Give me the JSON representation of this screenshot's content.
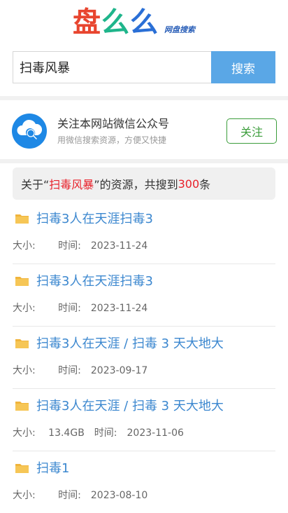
{
  "logo": {
    "char1": "盘",
    "char2": "么",
    "char3": "么",
    "subtitle": "网盘搜索"
  },
  "search": {
    "value": "扫毒风暴",
    "button": "搜索"
  },
  "wechat": {
    "title": "关注本网站微信公众号",
    "subtitle": "用微信搜索资源，方便又快捷",
    "button": "关注"
  },
  "summary": {
    "prefix": "关于“",
    "keyword": "扫毒风暴",
    "middle": "”的资源，共搜到",
    "count": "300",
    "suffix": "条"
  },
  "results": [
    {
      "title": "扫毒3人在天涯扫毒3",
      "size_label": "大小:",
      "size": "",
      "time_label": "时间:",
      "time": "2023-11-24"
    },
    {
      "title": "扫毒3人在天涯扫毒3",
      "size_label": "大小:",
      "size": "",
      "time_label": "时间:",
      "time": "2023-11-24"
    },
    {
      "title": "扫毒3人在天涯 / 扫毒 3 天大地大",
      "size_label": "大小:",
      "size": "",
      "time_label": "时间:",
      "time": "2023-09-17"
    },
    {
      "title": "扫毒3人在天涯 / 扫毒 3 天大地大",
      "size_label": "大小:",
      "size": "13.4GB",
      "time_label": "时间:",
      "time": "2023-11-06"
    },
    {
      "title": "扫毒1",
      "size_label": "大小:",
      "size": "",
      "time_label": "时间:",
      "time": "2023-08-10"
    }
  ],
  "colors": {
    "accent": "#5aa7e6",
    "link": "#3b87cf",
    "highlight": "#e8202a",
    "follow": "#3b9d3b"
  }
}
